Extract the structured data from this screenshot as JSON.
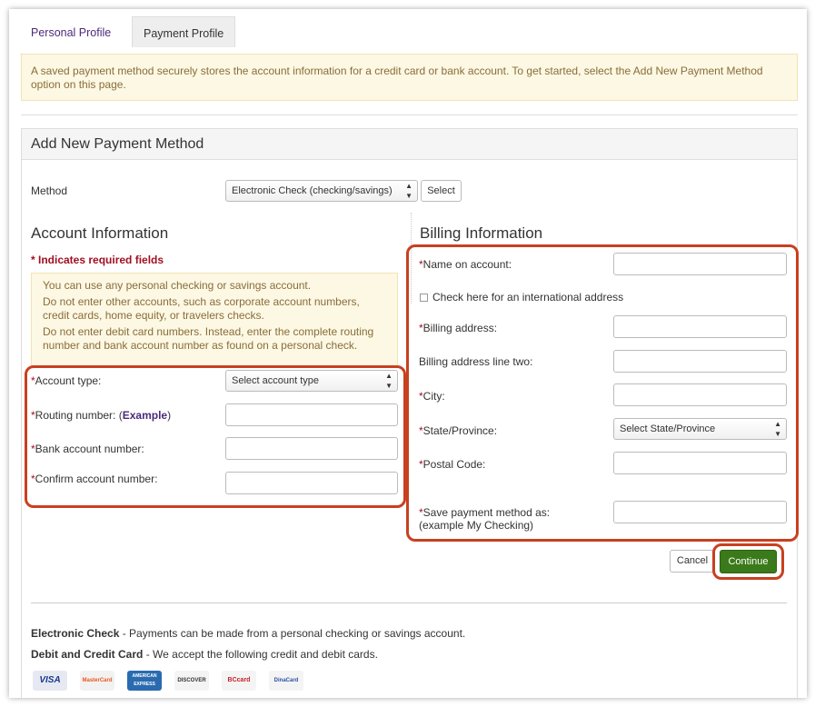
{
  "tabs": [
    {
      "label": "Personal Profile"
    },
    {
      "label": "Payment Profile"
    }
  ],
  "notice": "A saved payment method securely stores the account information for a credit card or bank account. To get started, select the Add New Payment Method option on this page.",
  "panel": {
    "title": "Add New Payment Method",
    "method_label": "Method",
    "method_value": "Electronic Check (checking/savings)",
    "select_button": "Select"
  },
  "account": {
    "heading": "Account Information",
    "required_note": "* Indicates required fields",
    "info": [
      "You can use any personal checking or savings account.",
      "Do not enter other accounts, such as corporate account numbers, credit cards, home equity, or travelers checks.",
      "Do not enter debit card numbers. Instead, enter the complete routing number and bank account number as found on a personal check."
    ],
    "account_type_label": "Account type:",
    "account_type_value": "Select account type",
    "routing_label": "Routing number: (",
    "routing_example": "Example",
    "routing_close": ")",
    "bank_label": "Bank account number:",
    "confirm_label": "Confirm account number:"
  },
  "billing": {
    "heading": "Billing Information",
    "name_label": "Name on account:",
    "intl_label": "Check here for an international address",
    "address_label": "Billing address:",
    "address2_label": "Billing address line two:",
    "city_label": "City:",
    "state_label": "State/Province:",
    "state_value": "Select State/Province",
    "postal_label": "Postal Code:",
    "save_label": "Save payment method as:",
    "save_hint": "(example My Checking)"
  },
  "actions": {
    "cancel": "Cancel",
    "continue": "Continue"
  },
  "footer": {
    "echeck_bold": "Electronic Check",
    "echeck_text": " - Payments can be made from a personal checking or savings  account.",
    "card_bold": "Debit and Credit Card",
    "card_text": " - We accept the following credit and debit cards.",
    "cards": [
      "VISA",
      "MasterCard",
      "AMERICAN EXPRESS",
      "DISCOVER",
      "BCcard",
      "DinaCard"
    ]
  },
  "colors": {
    "highlight": "#c8401f",
    "continue_bg": "#3b7a1a",
    "required": "#a10f1f",
    "tab_link": "#4b2a7b"
  }
}
